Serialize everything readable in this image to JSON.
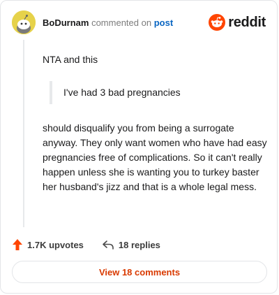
{
  "header": {
    "author": "BoDurnam",
    "commented_text": "commented on",
    "post_link": "post",
    "brand_word": "reddit"
  },
  "comment": {
    "intro": "NTA and this",
    "quote": "I've had 3 bad pregnancies",
    "text": "should disqualify you from being a surrogate anyway. They only want women who have had easy pregnancies free of complications. So it can't really happen unless she is wanting you to turkey baster her husband's jizz and that is a whole legal mess."
  },
  "actions": {
    "upvotes": "1.7K upvotes",
    "replies": "18 replies"
  },
  "view_comments": "View 18 comments",
  "colors": {
    "brand": "#ff4500",
    "link": "#0a66c2",
    "view_button_text": "#d93a00",
    "avatar": "#e6d24a"
  },
  "icons": {
    "upvote": "arrow-up-icon",
    "reply": "reply-arrow-icon",
    "brand": "reddit-snoo-icon",
    "avatar": "snoo-avatar-icon"
  }
}
